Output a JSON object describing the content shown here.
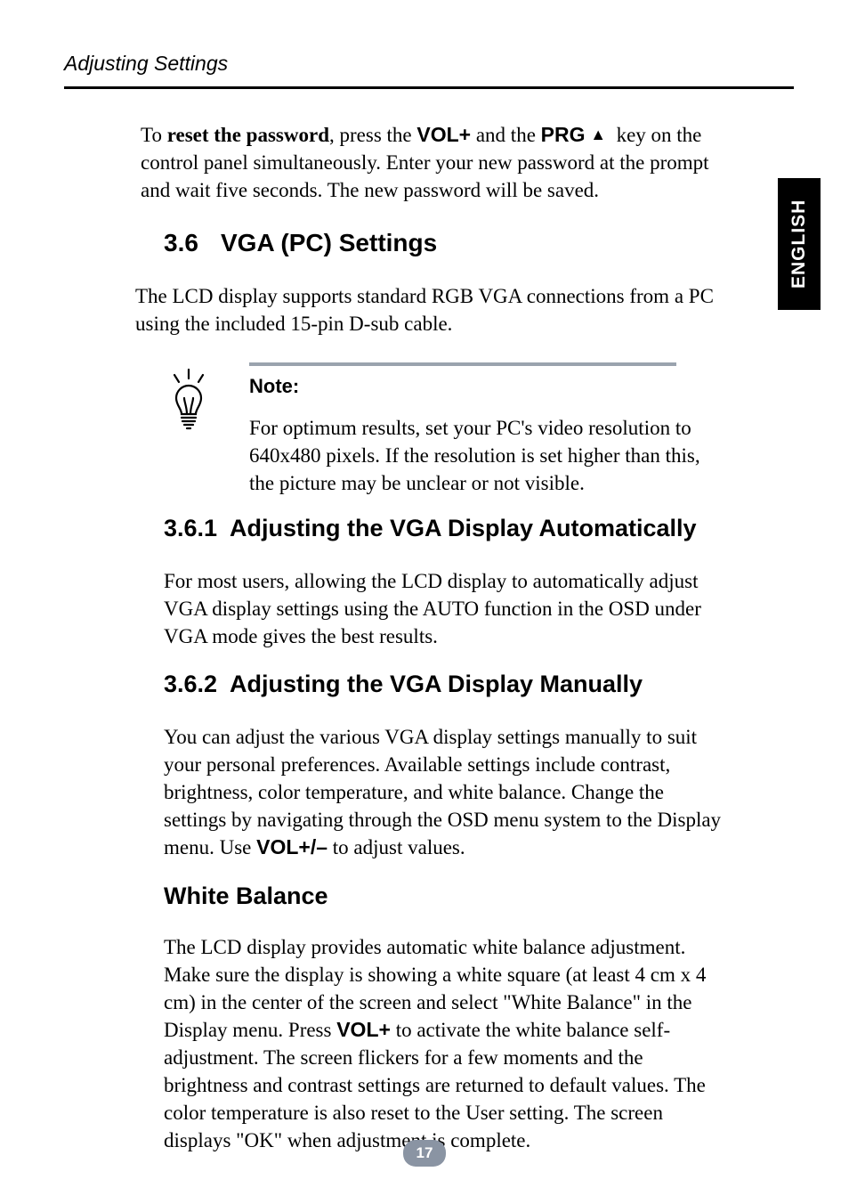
{
  "header": {
    "title": "Adjusting Settings"
  },
  "side_tab": "ENGLISH",
  "reset": {
    "seg1": "To ",
    "seg2": "reset the password",
    "seg3": ", press the ",
    "seg4": "VOL+",
    "seg5": " and the ",
    "seg6": "PRG",
    "seg7": " key on the control panel simultaneously. Enter your new password at the prompt and wait five seconds. The new password will be saved."
  },
  "h36": {
    "num": "3.6",
    "title": "VGA (PC) Settings"
  },
  "vga_intro": "The LCD display supports standard RGB VGA connections from a PC using the included 15-pin D-sub cable.",
  "note": {
    "label": "Note:",
    "body": "For optimum results, set your PC's video resolution to 640x480 pixels. If the resolution is set higher than this, the picture may be unclear or not visible."
  },
  "h361": {
    "num": "3.6.1",
    "title": "Adjusting the VGA Display Automatically"
  },
  "p361": "For most users, allowing the LCD display to automatically adjust VGA display settings using the AUTO function in the OSD under VGA mode gives the best results.",
  "h362": {
    "num": "3.6.2",
    "title": "Adjusting the VGA Display Manually"
  },
  "p362a": "You can adjust the various VGA display settings manually to suit your personal preferences. Available settings include contrast, brightness, color temperature, and white balance. Change the settings by navigating through the OSD menu system to the Display menu. Use ",
  "p362_vol": "VOL+/–",
  "p362b": " to adjust values.",
  "h_wb": "White Balance",
  "wb_a": "The LCD display provides automatic white balance adjustment. Make sure the display is showing a white square (at least 4 cm x 4 cm) in the center of the screen and select \"White Balance\" in the Display menu. Press ",
  "wb_vol": "VOL+",
  "wb_b": " to activate the white balance self-adjustment. The screen flickers for a few moments and the brightness and contrast settings are returned to default values. The color temperature is also reset to the User setting. The screen displays \"OK\" when adjustment is complete.",
  "page_number": "17"
}
